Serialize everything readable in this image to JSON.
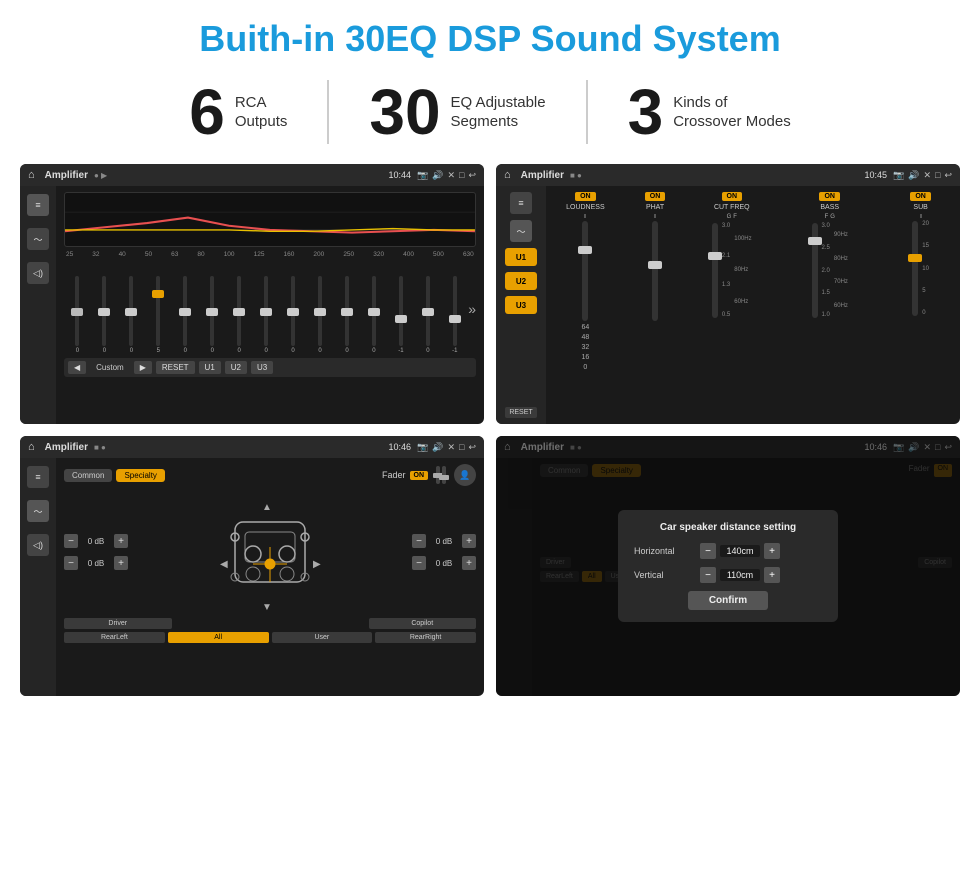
{
  "title": "Buith-in 30EQ DSP Sound System",
  "stats": [
    {
      "number": "6",
      "label": "RCA\nOutputs"
    },
    {
      "number": "30",
      "label": "EQ Adjustable\nSegments"
    },
    {
      "number": "3",
      "label": "Kinds of\nCrossover Modes"
    }
  ],
  "screens": [
    {
      "id": "eq-screen",
      "topbar": {
        "title": "Amplifier",
        "time": "10:44",
        "icons": [
          "📷",
          "🔊",
          "✕",
          "□",
          "↩"
        ]
      },
      "eq_freqs": [
        "25",
        "32",
        "40",
        "50",
        "63",
        "80",
        "100",
        "125",
        "160",
        "200",
        "250",
        "320",
        "400",
        "500",
        "630"
      ],
      "eq_values": [
        "0",
        "0",
        "0",
        "5",
        "0",
        "0",
        "0",
        "0",
        "0",
        "0",
        "0",
        "0",
        "-1",
        "0",
        "-1"
      ],
      "eq_preset": "Custom",
      "eq_buttons": [
        "RESET",
        "U1",
        "U2",
        "U3"
      ]
    },
    {
      "id": "crossover-screen",
      "topbar": {
        "title": "Amplifier",
        "time": "10:45",
        "icons": [
          "📷",
          "🔊",
          "✕",
          "□",
          "↩"
        ]
      },
      "presets": [
        "U1",
        "U2",
        "U3"
      ],
      "channels": [
        {
          "label": "LOUDNESS",
          "toggle": "ON",
          "values": [
            "64",
            "48",
            "32",
            "16",
            "0"
          ]
        },
        {
          "label": "PHAT",
          "toggle": "ON",
          "values": []
        },
        {
          "label": "CUT FREQ",
          "toggle": "ON",
          "sub_labels": [
            "G",
            "F"
          ],
          "freqs": [
            "3.0",
            "2.1",
            "1.3",
            "0.5"
          ],
          "hz": [
            "100Hz",
            "80Hz",
            "60Hz"
          ]
        },
        {
          "label": "BASS",
          "toggle": "ON",
          "sub_labels": [
            "F",
            "G"
          ],
          "freqs": [
            "3.0",
            "2.5",
            "2.0",
            "1.5",
            "1.0"
          ],
          "hz": [
            "90Hz",
            "80Hz",
            "70Hz",
            "60Hz"
          ]
        },
        {
          "label": "SUB",
          "toggle": "ON",
          "values": [
            "20",
            "15",
            "10",
            "5",
            "0"
          ]
        }
      ],
      "reset_btn": "RESET"
    },
    {
      "id": "fader-screen",
      "topbar": {
        "title": "Amplifier",
        "time": "10:46",
        "icons": [
          "📷",
          "🔊",
          "✕",
          "□",
          "↩"
        ]
      },
      "tabs": [
        "Common",
        "Specialty"
      ],
      "fader_label": "Fader",
      "fader_on": "ON",
      "channels": [
        {
          "label": "0 dB"
        },
        {
          "label": "0 dB"
        },
        {
          "label": "0 dB"
        },
        {
          "label": "0 dB"
        }
      ],
      "bottom_btns": [
        "Driver",
        "",
        "Copilot",
        "RearLeft",
        "All",
        "",
        "User",
        "RearRight"
      ]
    },
    {
      "id": "distance-screen",
      "topbar": {
        "title": "Amplifier",
        "time": "10:46",
        "icons": [
          "📷",
          "🔊",
          "✕",
          "□",
          "↩"
        ]
      },
      "tabs": [
        "Common",
        "Specialty"
      ],
      "dialog": {
        "title": "Car speaker distance setting",
        "horizontal_label": "Horizontal",
        "horizontal_value": "140cm",
        "vertical_label": "Vertical",
        "vertical_value": "110cm",
        "confirm_btn": "Confirm"
      },
      "bottom_btns": [
        "Driver",
        "Copilot",
        "RearLeft",
        "RearRight"
      ]
    }
  ],
  "colors": {
    "accent": "#e8a000",
    "title_blue": "#1a9bdc",
    "bg_dark": "#1a1a1a",
    "bg_medium": "#2a2a2a",
    "bg_light": "#3a3a3a",
    "text_light": "#eeeeee",
    "text_dim": "#aaaaaa"
  }
}
